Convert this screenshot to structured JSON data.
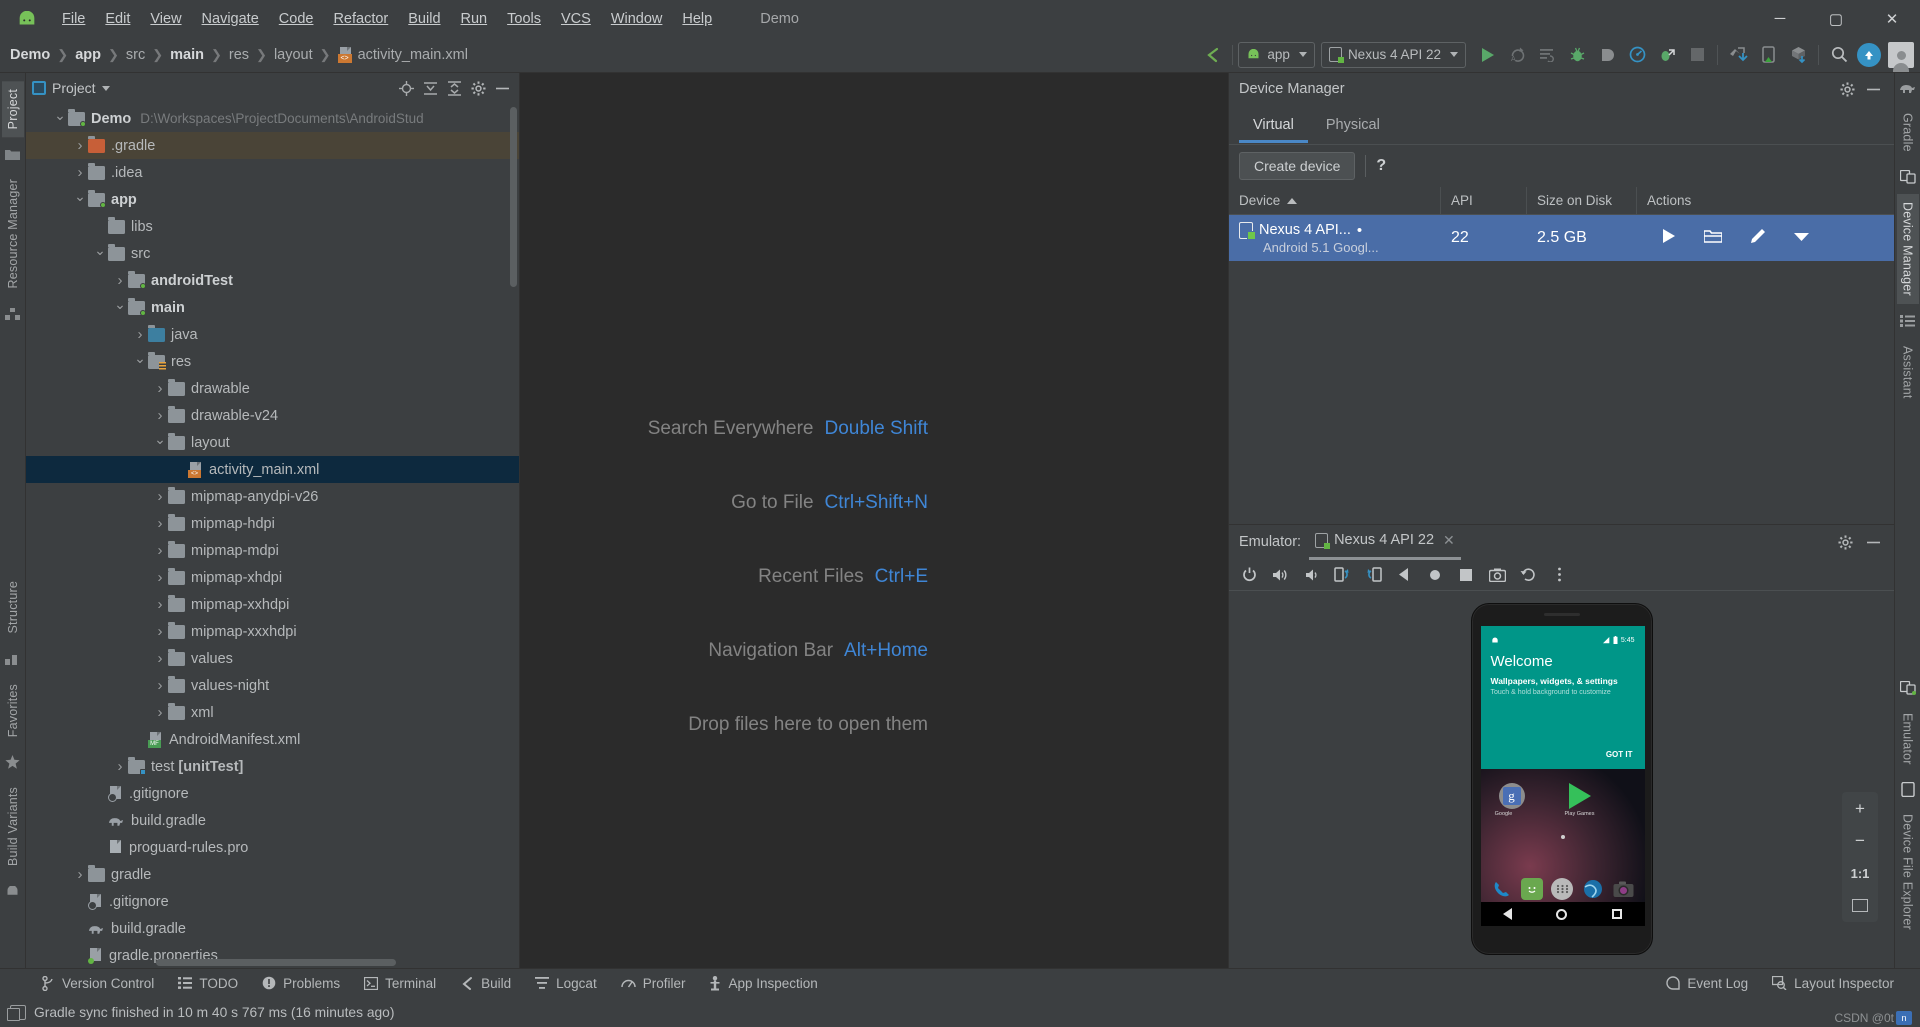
{
  "window": {
    "title": "Demo",
    "minimize": "─",
    "maximize": "▢",
    "close": "✕"
  },
  "menubar": {
    "logo": "android-logo-icon",
    "items": [
      {
        "label": "File",
        "mnemonic": "F"
      },
      {
        "label": "Edit",
        "mnemonic": "E"
      },
      {
        "label": "View",
        "mnemonic": "V"
      },
      {
        "label": "Navigate",
        "mnemonic": "N"
      },
      {
        "label": "Code",
        "mnemonic": "C"
      },
      {
        "label": "Refactor",
        "mnemonic": "R"
      },
      {
        "label": "Build",
        "mnemonic": "B"
      },
      {
        "label": "Run",
        "mnemonic": "n"
      },
      {
        "label": "Tools",
        "mnemonic": "T"
      },
      {
        "label": "VCS",
        "mnemonic": "S"
      },
      {
        "label": "Window",
        "mnemonic": "W"
      },
      {
        "label": "Help",
        "mnemonic": "H"
      }
    ],
    "project_label": "Demo"
  },
  "breadcrumb": {
    "items": [
      "Demo",
      "app",
      "src",
      "main",
      "res",
      "layout",
      "activity_main.xml"
    ]
  },
  "toolbar": {
    "module_selector": "app",
    "device_selector": "Nexus 4 API 22",
    "icons": [
      "make-project-icon",
      "run-icon",
      "apply-changes-icon",
      "rerun-icon",
      "debug-icon",
      "attach-debugger-icon",
      "profiler-icon",
      "debug-profile-icon",
      "stop-icon",
      "device-explorer-icon",
      "avd-manager-icon",
      "sdk-manager-icon",
      "search-icon",
      "update-icon",
      "account-avatar-icon"
    ]
  },
  "left_strip": {
    "tabs": [
      "Project",
      "Resource Manager",
      "Structure",
      "Favorites",
      "Build Variants"
    ]
  },
  "right_strip": {
    "tabs": [
      "Gradle",
      "Device Manager",
      "Assistant",
      "Emulator",
      "Device File Explorer"
    ]
  },
  "project_panel": {
    "title": "Project",
    "header_icons": [
      "locate-icon",
      "expand-all-icon",
      "collapse-all-icon",
      "settings-gear-icon",
      "hide-icon"
    ],
    "tree": [
      {
        "indent": 0,
        "arrow": "down",
        "icon": "module-folder",
        "label": "Demo",
        "bold": true,
        "path": "D:\\Workspaces\\ProjectDocuments\\AndroidStud",
        "state": "normal"
      },
      {
        "indent": 1,
        "arrow": "right",
        "icon": "folder-orange",
        "label": ".gradle",
        "bold": false,
        "path": "",
        "state": "hover"
      },
      {
        "indent": 1,
        "arrow": "right",
        "icon": "folder",
        "label": ".idea",
        "bold": false,
        "path": "",
        "state": "normal"
      },
      {
        "indent": 1,
        "arrow": "down",
        "icon": "module-folder",
        "label": "app",
        "bold": true,
        "path": "",
        "state": "normal"
      },
      {
        "indent": 2,
        "arrow": "none",
        "icon": "folder",
        "label": "libs",
        "bold": false,
        "path": "",
        "state": "normal"
      },
      {
        "indent": 2,
        "arrow": "down",
        "icon": "folder",
        "label": "src",
        "bold": false,
        "path": "",
        "state": "normal"
      },
      {
        "indent": 3,
        "arrow": "right",
        "icon": "module-folder",
        "label": "androidTest",
        "bold": true,
        "path": "",
        "state": "normal"
      },
      {
        "indent": 3,
        "arrow": "down",
        "icon": "module-folder",
        "label": "main",
        "bold": true,
        "path": "",
        "state": "normal"
      },
      {
        "indent": 4,
        "arrow": "right",
        "icon": "folder-blue",
        "label": "java",
        "bold": false,
        "path": "",
        "state": "normal"
      },
      {
        "indent": 4,
        "arrow": "down",
        "icon": "res-folder",
        "label": "res",
        "bold": false,
        "path": "",
        "state": "normal"
      },
      {
        "indent": 5,
        "arrow": "right",
        "icon": "folder",
        "label": "drawable",
        "bold": false,
        "path": "",
        "state": "normal"
      },
      {
        "indent": 5,
        "arrow": "right",
        "icon": "folder",
        "label": "drawable-v24",
        "bold": false,
        "path": "",
        "state": "normal"
      },
      {
        "indent": 5,
        "arrow": "down",
        "icon": "folder",
        "label": "layout",
        "bold": false,
        "path": "",
        "state": "normal"
      },
      {
        "indent": 6,
        "arrow": "none",
        "icon": "xml-file",
        "label": "activity_main.xml",
        "bold": false,
        "path": "",
        "state": "selected"
      },
      {
        "indent": 5,
        "arrow": "right",
        "icon": "folder",
        "label": "mipmap-anydpi-v26",
        "bold": false,
        "path": "",
        "state": "normal"
      },
      {
        "indent": 5,
        "arrow": "right",
        "icon": "folder",
        "label": "mipmap-hdpi",
        "bold": false,
        "path": "",
        "state": "normal"
      },
      {
        "indent": 5,
        "arrow": "right",
        "icon": "folder",
        "label": "mipmap-mdpi",
        "bold": false,
        "path": "",
        "state": "normal"
      },
      {
        "indent": 5,
        "arrow": "right",
        "icon": "folder",
        "label": "mipmap-xhdpi",
        "bold": false,
        "path": "",
        "state": "normal"
      },
      {
        "indent": 5,
        "arrow": "right",
        "icon": "folder",
        "label": "mipmap-xxhdpi",
        "bold": false,
        "path": "",
        "state": "normal"
      },
      {
        "indent": 5,
        "arrow": "right",
        "icon": "folder",
        "label": "mipmap-xxxhdpi",
        "bold": false,
        "path": "",
        "state": "normal"
      },
      {
        "indent": 5,
        "arrow": "right",
        "icon": "folder",
        "label": "values",
        "bold": false,
        "path": "",
        "state": "normal"
      },
      {
        "indent": 5,
        "arrow": "right",
        "icon": "folder",
        "label": "values-night",
        "bold": false,
        "path": "",
        "state": "normal"
      },
      {
        "indent": 5,
        "arrow": "right",
        "icon": "folder",
        "label": "xml",
        "bold": false,
        "path": "",
        "state": "normal"
      },
      {
        "indent": 4,
        "arrow": "none",
        "icon": "manifest-file",
        "label": "AndroidManifest.xml",
        "bold": false,
        "path": "",
        "state": "normal"
      },
      {
        "indent": 3,
        "arrow": "right",
        "icon": "module-folder-blue",
        "label": "test [unitTest]",
        "bold": false,
        "path": "",
        "state": "normal"
      },
      {
        "indent": 2,
        "arrow": "none",
        "icon": "gitignore-file",
        "label": ".gitignore",
        "bold": false,
        "path": "",
        "state": "normal"
      },
      {
        "indent": 2,
        "arrow": "none",
        "icon": "gradle-file",
        "label": "build.gradle",
        "bold": false,
        "path": "",
        "state": "normal"
      },
      {
        "indent": 2,
        "arrow": "none",
        "icon": "text-file",
        "label": "proguard-rules.pro",
        "bold": false,
        "path": "",
        "state": "normal"
      },
      {
        "indent": 1,
        "arrow": "right",
        "icon": "folder",
        "label": "gradle",
        "bold": false,
        "path": "",
        "state": "normal"
      },
      {
        "indent": 1,
        "arrow": "none",
        "icon": "gitignore-file",
        "label": ".gitignore",
        "bold": false,
        "path": "",
        "state": "normal"
      },
      {
        "indent": 1,
        "arrow": "none",
        "icon": "gradle-file",
        "label": "build.gradle",
        "bold": false,
        "path": "",
        "state": "normal"
      },
      {
        "indent": 1,
        "arrow": "none",
        "icon": "properties-file",
        "label": "gradle.properties",
        "bold": false,
        "path": "",
        "state": "normal"
      }
    ]
  },
  "editor": {
    "hints": [
      {
        "name": "Search Everywhere",
        "key": "Double Shift"
      },
      {
        "name": "Go to File",
        "key": "Ctrl+Shift+N"
      },
      {
        "name": "Recent Files",
        "key": "Ctrl+E"
      },
      {
        "name": "Navigation Bar",
        "key": "Alt+Home"
      }
    ],
    "drop_hint": "Drop files here to open them"
  },
  "device_manager": {
    "title": "Device Manager",
    "header_icons": [
      "settings-gear-icon",
      "hide-icon"
    ],
    "tabs": [
      {
        "label": "Virtual",
        "selected": true
      },
      {
        "label": "Physical",
        "selected": false
      }
    ],
    "create_device_button": "Create device",
    "help_button": "?",
    "columns": [
      "Device",
      "API",
      "Size on Disk",
      "Actions"
    ],
    "sort_column": "Device",
    "rows": [
      {
        "device_name": "Nexus 4 API...",
        "device_sub": "Android 5.1 Googl...",
        "api": "22",
        "size": "2.5 GB",
        "actions": [
          "launch-icon",
          "open-folder-icon",
          "edit-pencil-icon",
          "dropdown-caret-icon"
        ],
        "selected": true
      }
    ]
  },
  "emulator": {
    "label": "Emulator:",
    "tab_title": "Nexus 4 API 22",
    "close_tab": "✕",
    "header_icons": [
      "settings-gear-icon",
      "hide-icon"
    ],
    "toolbar_icons": [
      "power-icon",
      "volume-up-icon",
      "volume-down-icon",
      "rotate-left-icon",
      "rotate-right-icon",
      "back-icon",
      "home-icon",
      "overview-icon",
      "screenshot-camera-icon",
      "back-history-icon",
      "more-vertical-icon"
    ],
    "zoom_controls": {
      "zoom_in": "+",
      "zoom_out": "−",
      "actual_size": "1:1",
      "fit_screen": "fit-screen-icon"
    },
    "screen": {
      "status_time": "5:45",
      "welcome_title": "Welcome",
      "welcome_sub": "Wallpapers, widgets, & settings",
      "welcome_sub2": "Touch & hold background to customize",
      "got_it": "GOT IT",
      "app_icons": [
        {
          "label": "Google",
          "name": "google-search-icon"
        },
        {
          "label": "Play Games",
          "name": "play-games-icon"
        }
      ],
      "dock_icons": [
        "phone-icon",
        "messaging-icon",
        "all-apps-icon",
        "browser-icon",
        "camera-icon"
      ],
      "nav_buttons": [
        "back-nav-icon",
        "home-nav-icon",
        "recents-nav-icon"
      ]
    }
  },
  "tool_windows": {
    "left": [
      {
        "label": "Version Control",
        "icon": "branch-icon"
      },
      {
        "label": "TODO",
        "icon": "list-icon"
      },
      {
        "label": "Problems",
        "icon": "exclamation-icon"
      },
      {
        "label": "Terminal",
        "icon": "terminal-icon"
      },
      {
        "label": "Build",
        "icon": "hammer-icon"
      },
      {
        "label": "Logcat",
        "icon": "logcat-icon"
      },
      {
        "label": "Profiler",
        "icon": "gauge-icon"
      },
      {
        "label": "App Inspection",
        "icon": "inspection-icon"
      }
    ],
    "right": [
      {
        "label": "Event Log",
        "icon": "event-log-icon"
      },
      {
        "label": "Layout Inspector",
        "icon": "layout-inspector-icon"
      }
    ]
  },
  "status_bar": {
    "message": "Gradle sync finished in 10 m 40 s 767 ms (16 minutes ago)",
    "icon": "memory-icon",
    "watermark": "CSDN @0t"
  },
  "colors": {
    "accent_blue": "#4a88c7",
    "selection_blue": "#4a6da7",
    "tree_selection": "#0d293e",
    "hint_key": "#3f86d6",
    "android_green": "#62b543",
    "teal": "#009688",
    "panel_bg": "#3c3f41",
    "editor_bg": "#2b2b2b"
  }
}
